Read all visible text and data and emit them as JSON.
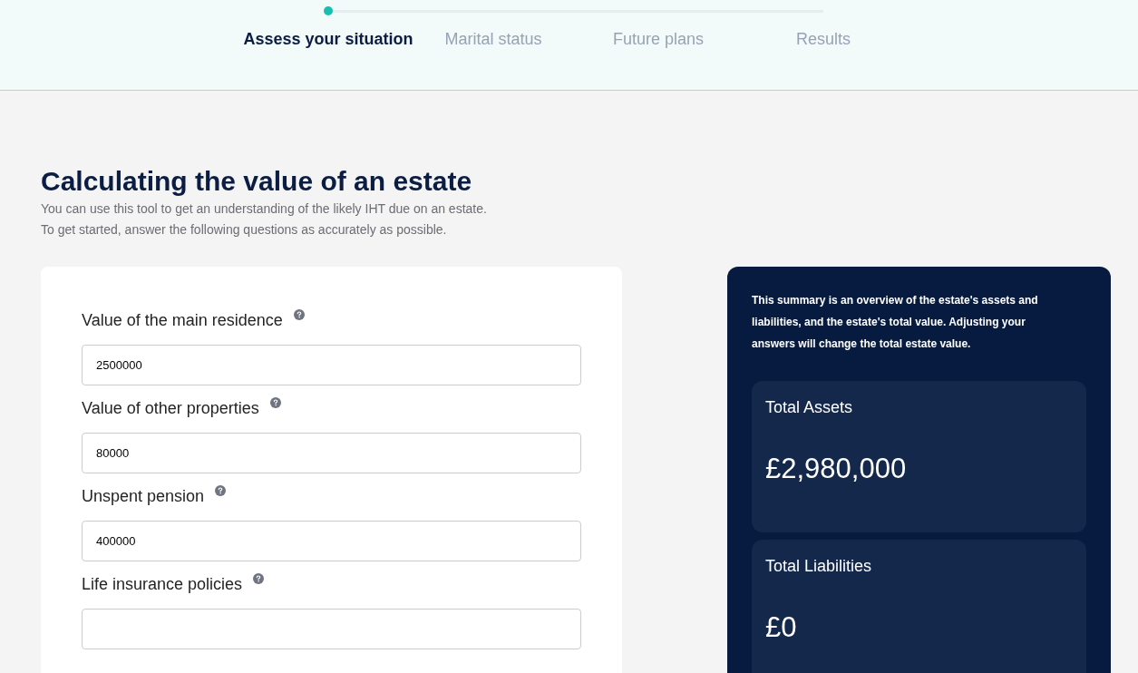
{
  "stepper": {
    "steps": [
      {
        "label": "Assess your situation",
        "selected": true
      },
      {
        "label": "Marital status",
        "selected": false
      },
      {
        "label": "Future plans",
        "selected": false
      },
      {
        "label": "Results",
        "selected": false
      }
    ]
  },
  "page": {
    "title": "Calculating the value of an estate",
    "intro": [
      "You can use this tool to get an understanding of the likely IHT due on an estate.",
      "To get started, answer the following questions as accurately as possible."
    ]
  },
  "form": {
    "fields": [
      {
        "label": "Value of the main residence",
        "value": "2500000"
      },
      {
        "label": "Value of other properties",
        "value": "80000"
      },
      {
        "label": "Unspent pension",
        "value": "400000"
      },
      {
        "label": "Life insurance policies"
      }
    ]
  },
  "summary": {
    "description": "This summary is an overview of the estate's assets and liabilities, and the estate's total value. Adjusting your answers will change the total estate value.",
    "totals": [
      {
        "label": "Total Assets",
        "value": "£2,980,000"
      },
      {
        "label": "Total Liabilities",
        "value": "£0"
      }
    ]
  }
}
